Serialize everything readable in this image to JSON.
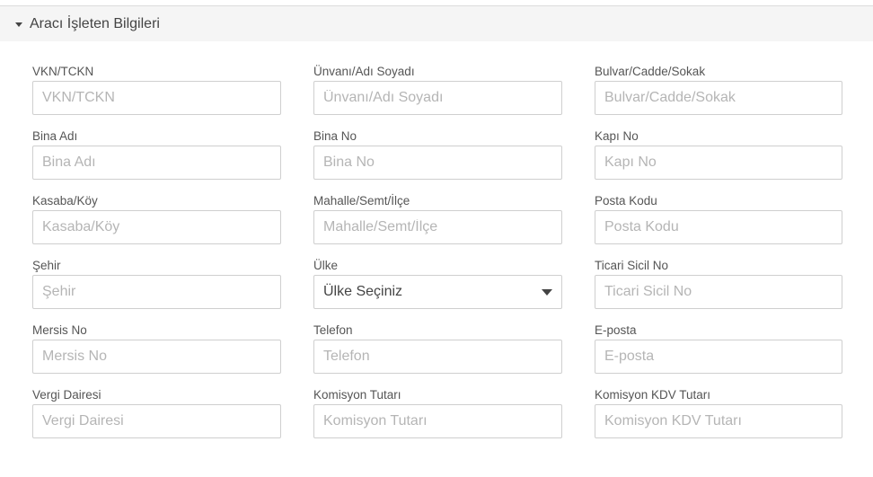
{
  "section": {
    "title": "Aracı İşleten Bilgileri",
    "expanded_icon": "caret-down-icon"
  },
  "rows": [
    [
      {
        "label": "VKN/TCKN",
        "placeholder": "VKN/TCKN",
        "value": ""
      },
      {
        "label": "Ünvanı/Adı Soyadı",
        "placeholder": "Ünvanı/Adı Soyadı",
        "value": ""
      },
      {
        "label": "Bulvar/Cadde/Sokak",
        "placeholder": "Bulvar/Cadde/Sokak",
        "value": ""
      }
    ],
    [
      {
        "label": "Bina Adı",
        "placeholder": "Bina Adı",
        "value": ""
      },
      {
        "label": "Bina No",
        "placeholder": "Bina No",
        "value": ""
      },
      {
        "label": "Kapı No",
        "placeholder": "Kapı No",
        "value": ""
      }
    ],
    [
      {
        "label": "Kasaba/Köy",
        "placeholder": "Kasaba/Köy",
        "value": ""
      },
      {
        "label": "Mahalle/Semt/İlçe",
        "placeholder": "Mahalle/Semt/İlçe",
        "value": ""
      },
      {
        "label": "Posta Kodu",
        "placeholder": "Posta Kodu",
        "value": ""
      }
    ],
    [
      {
        "label": "Şehir",
        "placeholder": "Şehir",
        "value": ""
      },
      {
        "label": "Ülke",
        "selected": "Ülke Seçiniz"
      },
      {
        "label": "Ticari Sicil No",
        "placeholder": "Ticari Sicil No",
        "value": ""
      }
    ],
    [
      {
        "label": "Mersis No",
        "placeholder": "Mersis No",
        "value": ""
      },
      {
        "label": "Telefon",
        "placeholder": "Telefon",
        "value": ""
      },
      {
        "label": "E-posta",
        "placeholder": "E-posta",
        "value": ""
      }
    ],
    [
      {
        "label": "Vergi Dairesi",
        "placeholder": "Vergi Dairesi",
        "value": ""
      },
      {
        "label": "Komisyon Tutarı",
        "placeholder": "Komisyon Tutarı",
        "value": ""
      },
      {
        "label": "Komisyon KDV Tutarı",
        "placeholder": "Komisyon KDV Tutarı",
        "value": ""
      }
    ]
  ]
}
